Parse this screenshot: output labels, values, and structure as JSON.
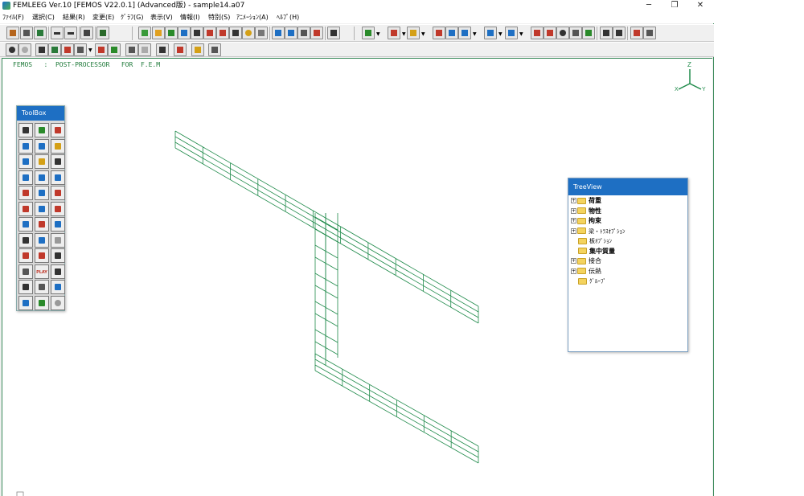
{
  "window": {
    "title": "FEMLEEG Ver.10 [FEMOS V22.0.1] (Advanced版) - sample14.a07",
    "minimize": "─",
    "restore": "❐",
    "close": "✕"
  },
  "menu": [
    "ﾌｧｲﾙ(F)",
    "選択(C)",
    "結果(R)",
    "変更(E)",
    "ｸﾞﾗﾌ(G)",
    "表示(V)",
    "情報(I)",
    "特別(S)",
    "ｱﾆﾒｰｼｮﾝ(A)",
    "ﾍﾙﾌﾟ(H)"
  ],
  "canvas_header": "FEMOS   :  POST-PROCESSOR   FOR  F.E.M",
  "axis_labels": {
    "z": "Z",
    "x": "X",
    "y": "Y"
  },
  "toolbox": {
    "title": "ToolBox",
    "play_label": "PLAY"
  },
  "treeview": {
    "title": "TreeView",
    "items": [
      {
        "label": "荷重",
        "expandable": true
      },
      {
        "label": "物性",
        "expandable": true
      },
      {
        "label": "拘束",
        "expandable": true
      },
      {
        "label": "梁・ﾄﾗｽｵﾌﾟｼｮﾝ",
        "expandable": true
      },
      {
        "label": "板ｵﾌﾟｼｮﾝ",
        "expandable": false
      },
      {
        "label": "集中質量",
        "expandable": false
      },
      {
        "label": "接合",
        "expandable": true
      },
      {
        "label": "伝熱",
        "expandable": true
      },
      {
        "label": "ｸﾞﾙｰﾌﾟ",
        "expandable": false
      }
    ]
  },
  "colors": {
    "mesh": "#1f8a4a",
    "accent": "#1e6fc3"
  }
}
